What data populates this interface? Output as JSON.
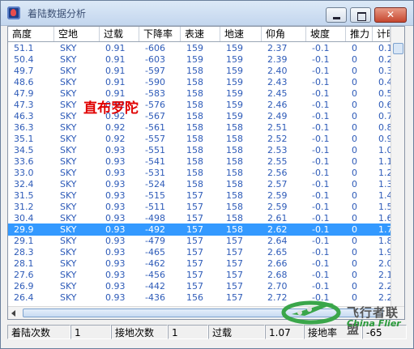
{
  "window": {
    "title": "着陆数据分析"
  },
  "columns": [
    "高度",
    "空地",
    "过载",
    "下降率",
    "表速",
    "地速",
    "仰角",
    "坡度",
    "推力",
    "计时"
  ],
  "rows": [
    [
      "51.1",
      "SKY",
      "0.91",
      "-606",
      "159",
      "159",
      "2.37",
      "-0.1",
      "0",
      "0.1"
    ],
    [
      "50.4",
      "SKY",
      "0.91",
      "-603",
      "159",
      "159",
      "2.39",
      "-0.1",
      "0",
      "0.2"
    ],
    [
      "49.7",
      "SKY",
      "0.91",
      "-597",
      "158",
      "159",
      "2.40",
      "-0.1",
      "0",
      "0.3"
    ],
    [
      "48.6",
      "SKY",
      "0.91",
      "-590",
      "158",
      "159",
      "2.43",
      "-0.1",
      "0",
      "0.4"
    ],
    [
      "47.9",
      "SKY",
      "0.91",
      "-583",
      "158",
      "159",
      "2.45",
      "-0.1",
      "0",
      "0.5"
    ],
    [
      "47.3",
      "SKY",
      "0.92",
      "-576",
      "158",
      "159",
      "2.46",
      "-0.1",
      "0",
      "0.6"
    ],
    [
      "46.3",
      "SKY",
      "0.92",
      "-567",
      "158",
      "159",
      "2.49",
      "-0.1",
      "0",
      "0.7"
    ],
    [
      "36.3",
      "SKY",
      "0.92",
      "-561",
      "158",
      "158",
      "2.51",
      "-0.1",
      "0",
      "0.8"
    ],
    [
      "35.1",
      "SKY",
      "0.92",
      "-557",
      "158",
      "158",
      "2.52",
      "-0.1",
      "0",
      "0.9"
    ],
    [
      "34.5",
      "SKY",
      "0.93",
      "-551",
      "158",
      "158",
      "2.53",
      "-0.1",
      "0",
      "1.0"
    ],
    [
      "33.6",
      "SKY",
      "0.93",
      "-541",
      "158",
      "158",
      "2.55",
      "-0.1",
      "0",
      "1.1"
    ],
    [
      "33.0",
      "SKY",
      "0.93",
      "-531",
      "158",
      "158",
      "2.56",
      "-0.1",
      "0",
      "1.2"
    ],
    [
      "32.4",
      "SKY",
      "0.93",
      "-524",
      "158",
      "158",
      "2.57",
      "-0.1",
      "0",
      "1.3"
    ],
    [
      "31.5",
      "SKY",
      "0.93",
      "-515",
      "157",
      "158",
      "2.59",
      "-0.1",
      "0",
      "1.4"
    ],
    [
      "31.2",
      "SKY",
      "0.93",
      "-511",
      "157",
      "158",
      "2.59",
      "-0.1",
      "0",
      "1.5"
    ],
    [
      "30.4",
      "SKY",
      "0.93",
      "-498",
      "157",
      "158",
      "2.61",
      "-0.1",
      "0",
      "1.6"
    ],
    [
      "29.9",
      "SKY",
      "0.93",
      "-492",
      "157",
      "158",
      "2.62",
      "-0.1",
      "0",
      "1.7"
    ],
    [
      "29.1",
      "SKY",
      "0.93",
      "-479",
      "157",
      "157",
      "2.64",
      "-0.1",
      "0",
      "1.8"
    ],
    [
      "28.3",
      "SKY",
      "0.93",
      "-465",
      "157",
      "157",
      "2.65",
      "-0.1",
      "0",
      "1.9"
    ],
    [
      "28.1",
      "SKY",
      "0.93",
      "-462",
      "157",
      "157",
      "2.66",
      "-0.1",
      "0",
      "2.0"
    ],
    [
      "27.6",
      "SKY",
      "0.93",
      "-456",
      "157",
      "157",
      "2.68",
      "-0.1",
      "0",
      "2.1"
    ],
    [
      "26.9",
      "SKY",
      "0.93",
      "-442",
      "157",
      "157",
      "2.70",
      "-0.1",
      "0",
      "2.2"
    ],
    [
      "26.4",
      "SKY",
      "0.93",
      "-436",
      "156",
      "157",
      "2.72",
      "-0.1",
      "0",
      "2.2"
    ]
  ],
  "selected_row": 16,
  "overlay_text": "直布罗陀",
  "status": [
    {
      "label": "着陆次数"
    },
    {
      "value": "1"
    },
    {
      "label": "接地次数"
    },
    {
      "value": "1"
    },
    {
      "label": "过载"
    },
    {
      "value": "1.07"
    },
    {
      "label": "接地率"
    },
    {
      "value": "-65"
    }
  ],
  "watermark": {
    "line1": "飞行者联盟",
    "line2": "China Flier"
  },
  "colors": {
    "selection": "#3399ff",
    "cell_text": "#2e5bb8",
    "overlay": "#e00000"
  }
}
